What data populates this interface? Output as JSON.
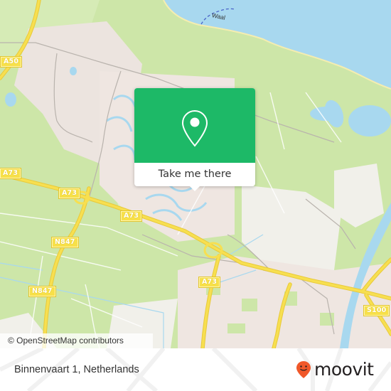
{
  "map": {
    "water_labels": [
      {
        "text": "Waal"
      }
    ],
    "road_labels": [
      {
        "text": "A50"
      },
      {
        "text": "A73"
      },
      {
        "text": "A73"
      },
      {
        "text": "A73"
      },
      {
        "text": "A73"
      },
      {
        "text": "N847"
      },
      {
        "text": "N847"
      },
      {
        "text": "S100"
      }
    ],
    "attribution": "© OpenStreetMap contributors",
    "colors": {
      "land": "#cde6a8",
      "urban": "#efe6e1",
      "water": "#a8d8ef",
      "highway": "#f7df50",
      "minor_road": "#ffffff"
    }
  },
  "popup": {
    "icon": "map-pin-icon",
    "action_label": "Take me there",
    "accent_color": "#1db967"
  },
  "footer": {
    "address": "Binnenvaart 1, Netherlands",
    "brand_name": "moovit",
    "brand_icon": "moovit-smiley-pin-icon",
    "brand_color": "#f0582a"
  }
}
